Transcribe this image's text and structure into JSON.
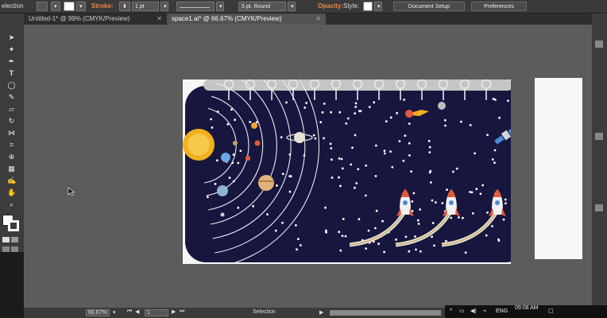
{
  "control_bar": {
    "workspace_label": "election",
    "stroke_label": "Stroke:",
    "stroke_weight": "1 pt",
    "profile_label": "Uniform",
    "brush_label": "5 pt. Round",
    "opacity_label": "Opacity:",
    "style_label": "Style:",
    "document_setup": "Document Setup",
    "preferences": "Preferences"
  },
  "tabs": [
    {
      "label": "Untitled-1* @ 99% (CMYK/Preview)",
      "active": false
    },
    {
      "label": "space1.ai* @ 66.67% (CMYK/Preview)",
      "active": true
    }
  ],
  "status_bar": {
    "zoom": "66.67%",
    "artboard_number": "1",
    "tool_name": "Selection"
  },
  "taskbar": {
    "language": "ENG",
    "time": "09:08 AM"
  },
  "colors": {
    "night_sky": "#16163f",
    "track_gray": "#c5c5c5",
    "sun": "#f2b01e",
    "accent_orange": "#e8894a"
  },
  "artwork": {
    "planets": [
      "sun",
      "mercury",
      "venus",
      "earth",
      "mars",
      "jupiter",
      "saturn",
      "uranus",
      "neptune"
    ],
    "rockets": 3,
    "objects": [
      "comet",
      "asteroid",
      "satellite"
    ]
  }
}
